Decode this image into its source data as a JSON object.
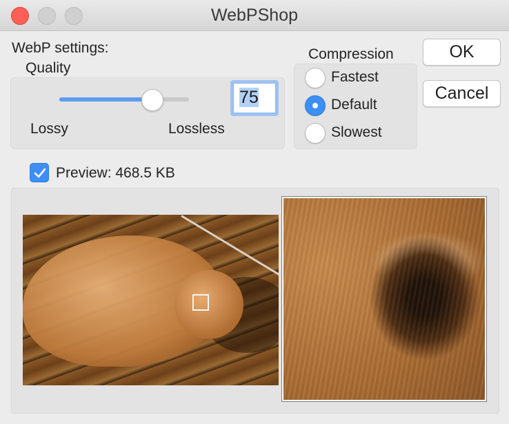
{
  "window": {
    "title": "WebPShop"
  },
  "settings": {
    "header": "WebP settings:",
    "quality": {
      "label": "Quality",
      "value": "75",
      "slider_fraction": 0.75,
      "min_label": "Lossy",
      "max_label": "Lossless"
    }
  },
  "compression": {
    "label": "Compression",
    "options": [
      "Fastest",
      "Default",
      "Slowest"
    ],
    "selected": "Default"
  },
  "buttons": {
    "ok": "OK",
    "cancel": "Cancel"
  },
  "preview": {
    "checked": true,
    "label": "Preview: 468.5 KB"
  },
  "colors": {
    "accent": "#3d8ef5",
    "close_button": "#fd5f57"
  },
  "icons": {
    "close": "close-traffic-light",
    "minimize": "minimize-traffic-light",
    "maximize": "maximize-traffic-light",
    "checkmark": "checkmark-icon"
  }
}
